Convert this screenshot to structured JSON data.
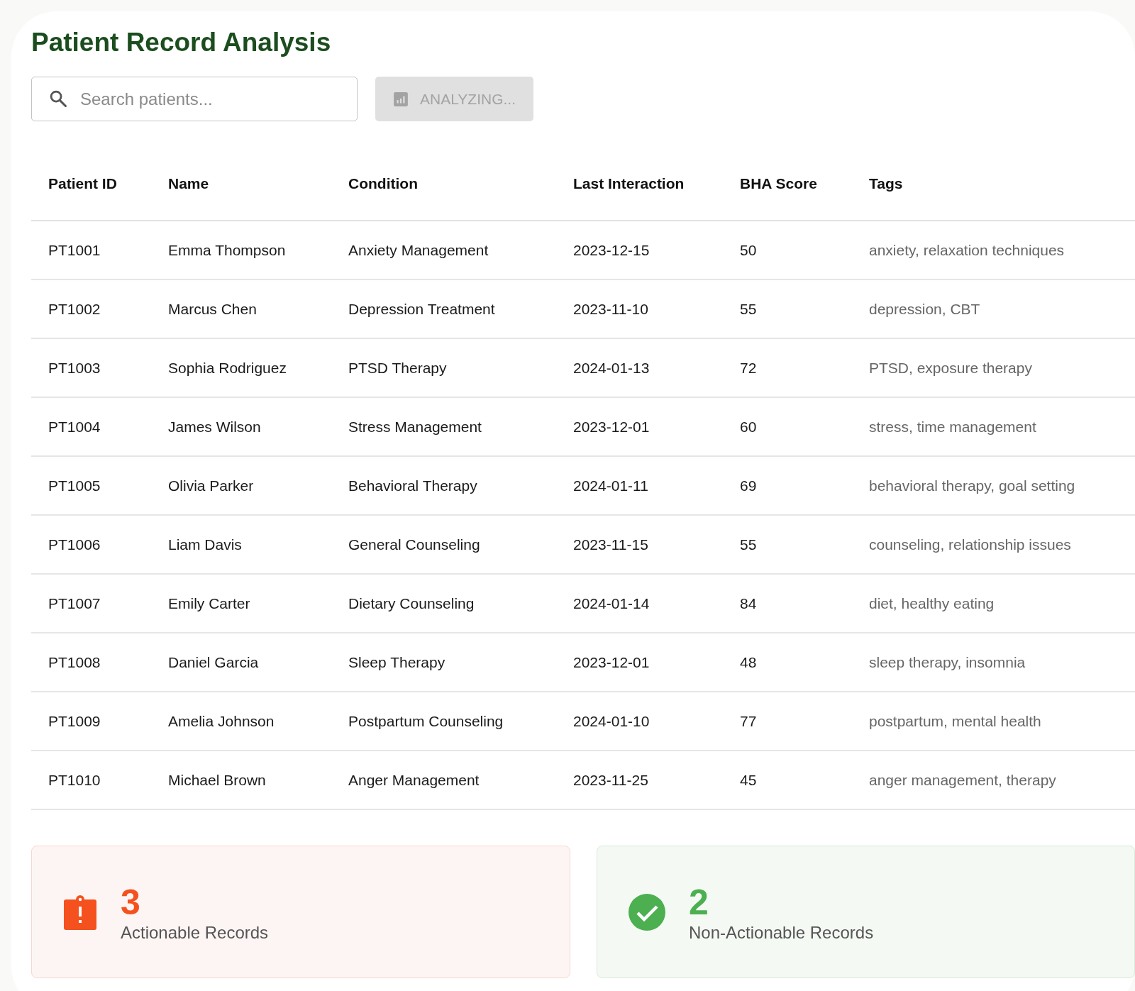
{
  "title": "Patient Record Analysis",
  "search": {
    "placeholder": "Search patients..."
  },
  "analyze_button": {
    "label": "ANALYZING...",
    "disabled": true
  },
  "table": {
    "columns": [
      "Patient ID",
      "Name",
      "Condition",
      "Last Interaction",
      "BHA Score",
      "Tags"
    ],
    "rows": [
      [
        "PT1001",
        "Emma Thompson",
        "Anxiety Management",
        "2023-12-15",
        "50",
        "anxiety, relaxation techniques"
      ],
      [
        "PT1002",
        "Marcus Chen",
        "Depression Treatment",
        "2023-11-10",
        "55",
        "depression, CBT"
      ],
      [
        "PT1003",
        "Sophia Rodriguez",
        "PTSD Therapy",
        "2024-01-13",
        "72",
        "PTSD, exposure therapy"
      ],
      [
        "PT1004",
        "James Wilson",
        "Stress Management",
        "2023-12-01",
        "60",
        "stress, time management"
      ],
      [
        "PT1005",
        "Olivia Parker",
        "Behavioral Therapy",
        "2024-01-11",
        "69",
        "behavioral therapy, goal setting"
      ],
      [
        "PT1006",
        "Liam Davis",
        "General Counseling",
        "2023-11-15",
        "55",
        "counseling, relationship issues"
      ],
      [
        "PT1007",
        "Emily Carter",
        "Dietary Counseling",
        "2024-01-14",
        "84",
        "diet, healthy eating"
      ],
      [
        "PT1008",
        "Daniel Garcia",
        "Sleep Therapy",
        "2023-12-01",
        "48",
        "sleep therapy, insomnia"
      ],
      [
        "PT1009",
        "Amelia Johnson",
        "Postpartum Counseling",
        "2024-01-10",
        "77",
        "postpartum, mental health"
      ],
      [
        "PT1010",
        "Michael Brown",
        "Anger Management",
        "2023-11-25",
        "45",
        "anger management, therapy"
      ]
    ]
  },
  "summary": [
    {
      "kind": "actionable",
      "count": "3",
      "label": "Actionable Records"
    },
    {
      "kind": "non_actionable",
      "count": "2",
      "label": "Non-Actionable Records"
    }
  ]
}
